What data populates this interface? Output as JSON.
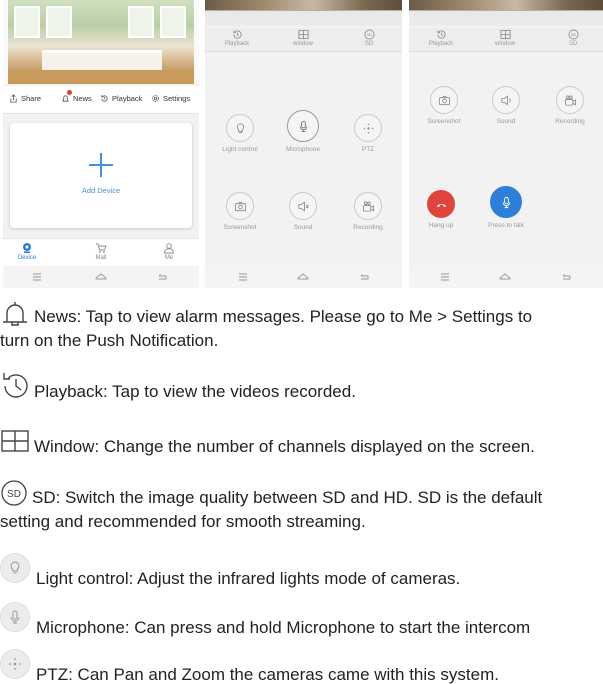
{
  "phone1": {
    "actions": {
      "share": "Share",
      "news": "News",
      "playback": "Playback",
      "settings": "Settings"
    },
    "add_device": "Add Device",
    "tabs": {
      "device": "Device",
      "mall": "Mall",
      "me": "Me"
    }
  },
  "phone2": {
    "toolbar": {
      "playback": "Playback",
      "window": "window",
      "sd": "SD"
    },
    "controls": {
      "light": "Light control",
      "mic": "Microphone",
      "ptz": "PTZ",
      "screenshot": "Screenshot",
      "sound": "Sound",
      "recording": "Recording"
    }
  },
  "phone3": {
    "toolbar": {
      "playback": "Playback",
      "window": "window",
      "sd": "SD"
    },
    "controls": {
      "screenshot": "Screenshot",
      "sound": "Sound",
      "recording": "Recording",
      "hangup": "Hang up",
      "press_to_talk": "Press to talk"
    }
  },
  "descriptions": {
    "news_line1": "News: Tap to view alarm messages. Please go to Me > Settings to",
    "news_line2": "turn on the Push Notification.",
    "playback": "Playback: Tap to view the videos recorded.",
    "window": "Window: Change the number of channels displayed on the screen.",
    "sd_icon": "SD",
    "sd_line1": "SD: Switch the image quality between SD and HD. SD is the default",
    "sd_line2": "setting and recommended for smooth streaming.",
    "light": "Light control: Adjust the infrared lights mode of cameras.",
    "mic": "Microphone: Can press and hold Microphone to start the intercom",
    "ptz": "PTZ: Can Pan and Zoom the cameras came with this system."
  },
  "colors": {
    "accent": "#2f7fd9",
    "hangup": "#e0453d",
    "badge": "#e53935"
  }
}
